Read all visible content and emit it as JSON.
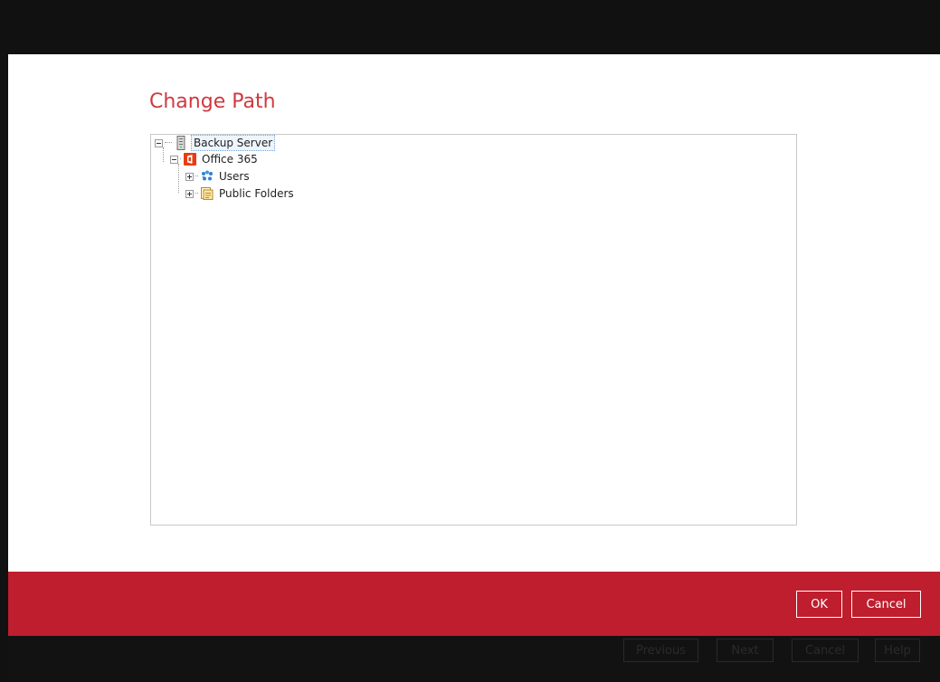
{
  "dialog": {
    "title": "Change Path",
    "accent_color": "#d0393f"
  },
  "tree": {
    "items": [
      {
        "label": "Backup Server",
        "icon": "server-icon",
        "expanded": true,
        "selected": true
      },
      {
        "label": "Office 365",
        "icon": "office365-icon",
        "expanded": true
      },
      {
        "label": "Users",
        "icon": "users-icon",
        "expanded": false
      },
      {
        "label": "Public Folders",
        "icon": "public-folders-icon",
        "expanded": false
      }
    ]
  },
  "actions": {
    "ok_label": "OK",
    "cancel_label": "Cancel",
    "bar_color": "#bf1e2e"
  },
  "wizard_nav": {
    "previous_label": "Previous",
    "next_label": "Next",
    "cancel_label": "Cancel",
    "help_label": "Help"
  }
}
